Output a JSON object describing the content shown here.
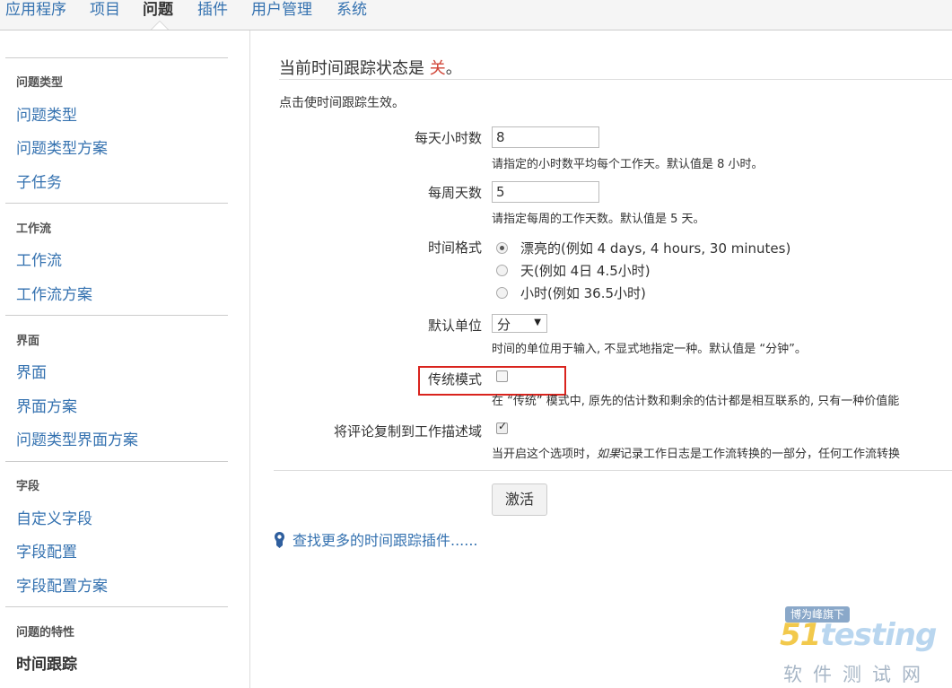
{
  "nav": {
    "tabs": [
      "应用程序",
      "项目",
      "问题",
      "插件",
      "用户管理",
      "系统"
    ],
    "active": "问题"
  },
  "sidebar": {
    "sections": [
      {
        "heading": "问题类型",
        "items": [
          "问题类型",
          "问题类型方案",
          "子任务"
        ]
      },
      {
        "heading": "工作流",
        "items": [
          "工作流",
          "工作流方案"
        ]
      },
      {
        "heading": "界面",
        "items": [
          "界面",
          "界面方案",
          "问题类型界面方案"
        ]
      },
      {
        "heading": "字段",
        "items": [
          "自定义字段",
          "字段配置",
          "字段配置方案"
        ]
      },
      {
        "heading": "问题的特性",
        "items": [
          "时间跟踪"
        ]
      }
    ],
    "current": "时间跟踪"
  },
  "main": {
    "title_prefix": "当前时间跟踪状态是 ",
    "title_status": "关",
    "title_suffix": "。",
    "intro": "点击使时间跟踪生效。",
    "hours_per_day": {
      "label": "每天小时数",
      "value": "8",
      "desc": "请指定的小时数平均每个工作天。默认值是 8 小时。"
    },
    "days_per_week": {
      "label": "每周天数",
      "value": "5",
      "desc": "请指定每周的工作天数。默认值是 5 天。"
    },
    "time_format": {
      "label": "时间格式",
      "options": [
        "漂亮的(例如 4 days, 4 hours, 30 minutes)",
        "天(例如 4日 4.5小时)",
        "小时(例如 36.5小时)"
      ],
      "selected_index": 0
    },
    "default_unit": {
      "label": "默认单位",
      "value": "分",
      "desc": "时间的单位用于输入, 不显式地指定一种。默认值是 “分钟”。"
    },
    "legacy_mode": {
      "label": "传统模式",
      "checked": false,
      "desc": "在 “传统” 模式中, 原先的估计数和剩余的估计都是相互联系的, 只有一种价值能"
    },
    "copy_comment": {
      "label": "将评论复制到工作描述域",
      "checked": true,
      "desc_prefix": "当开启这个选项时，",
      "desc_em": "如果",
      "desc_suffix": "记录工作日志是工作流转换的一部分，任何工作流转换"
    },
    "activate_button": "激活",
    "plugin_link": "查找更多的时间跟踪插件......"
  },
  "watermark": {
    "badge": "博为峰旗下",
    "logo_num": "51",
    "logo_text": "testing",
    "sub": "软件测试网"
  },
  "colors": {
    "link": "#3572b0",
    "status_off": "#d04437",
    "highlight_box": "#d9231d"
  }
}
